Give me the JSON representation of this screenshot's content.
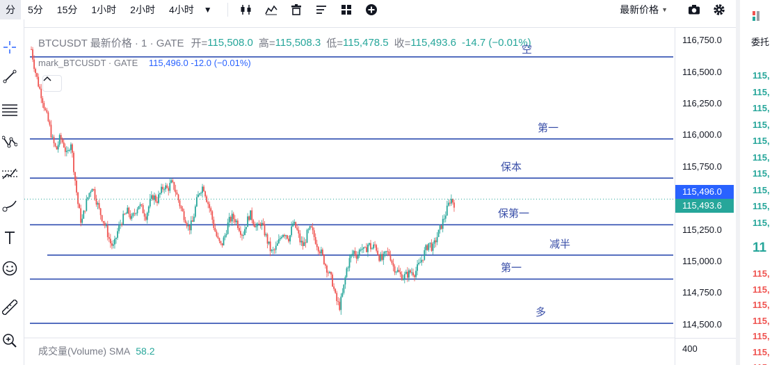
{
  "toolbar": {
    "timeframes": [
      "分",
      "5分",
      "15分",
      "1小时",
      "2小时",
      "4小时"
    ],
    "price_type": "最新价格"
  },
  "chart": {
    "symbol": "BTCUSDT 最新价格 · 1 · GATE",
    "open_label": "开=",
    "open": "115,508.0",
    "high_label": "高=",
    "high": "115,508.3",
    "low_label": "低=",
    "low": "115,478.5",
    "close_label": "收=",
    "close": "115,493.6",
    "change": "-14.7 (−0.01%)",
    "mark_symbol": "mark_BTCUSDT · GATE",
    "mark_value": "115,496.0 -12.0 (−0.01%)",
    "volume_label": "成交量(Volume) SMA",
    "volume_value": "58.2",
    "levels": [
      {
        "label": "空",
        "price": 116620
      },
      {
        "label": "第一",
        "price": 115970
      },
      {
        "label": "保本",
        "price": 115660
      },
      {
        "label": "保第一",
        "price": 115290
      },
      {
        "label": "减半",
        "price": 115050
      },
      {
        "label": "第一",
        "price": 114860
      },
      {
        "label": "多",
        "price": 114510
      }
    ]
  },
  "axis": {
    "ticks": [
      "116,750.0",
      "116,500.0",
      "116,250.0",
      "116,000.0",
      "115,750.0",
      "115,250.0",
      "115,000.0",
      "114,750.0",
      "114,500.0"
    ],
    "mark_badge": "115,496.0",
    "last_badge": "115,493.6",
    "volume_tick": "400",
    "colors": {
      "mark": "#2962ff",
      "last": "#26a69a",
      "level": "#2f4eb0"
    }
  },
  "orderbook": {
    "title": "委托",
    "asks": [
      "115,",
      "115,",
      "115,",
      "115,",
      "115,",
      "115,",
      "115,",
      "115,",
      "115,",
      "115,"
    ],
    "mid": "11",
    "bids": [
      "115,",
      "115,",
      "115,",
      "115,",
      "115,",
      "115,",
      "115,"
    ]
  },
  "chart_data": {
    "type": "candlestick",
    "price_range": [
      114400,
      116850
    ],
    "series": [
      {
        "name": "BTCUSDT",
        "values": [
          116680,
          116520,
          116400,
          116300,
          116180,
          116080,
          115950,
          115880,
          115980,
          115930,
          115830,
          115960,
          115700,
          115460,
          115300,
          115430,
          115530,
          115600,
          115500,
          115400,
          115330,
          115250,
          115150,
          115110,
          115230,
          115310,
          115360,
          115400,
          115330,
          115400,
          115450,
          115410,
          115360,
          115460,
          115520,
          115480,
          115540,
          115600,
          115570,
          115620,
          115580,
          115490,
          115400,
          115340,
          115260,
          115310,
          115460,
          115560,
          115600,
          115490,
          115400,
          115270,
          115170,
          115120,
          115200,
          115310,
          115350,
          115330,
          115270,
          115210,
          115300,
          115380,
          115320,
          115260,
          115310,
          115240,
          115150,
          115070,
          115090,
          115150,
          115230,
          115220,
          115180,
          115300,
          115260,
          115160,
          115120,
          115220,
          115260,
          115190,
          115120,
          115060,
          114980,
          114910,
          114840,
          114700,
          114640,
          114760,
          114940,
          115030,
          115080,
          115040,
          115120,
          115070,
          115140,
          115100,
          115130,
          115040,
          115010,
          115070,
          115060,
          114960,
          114930,
          114890,
          114880,
          114900,
          114920,
          114910,
          114960,
          115020,
          115090,
          115150,
          115100,
          115180,
          115250,
          115330,
          115410,
          115500,
          115460
        ]
      }
    ]
  }
}
